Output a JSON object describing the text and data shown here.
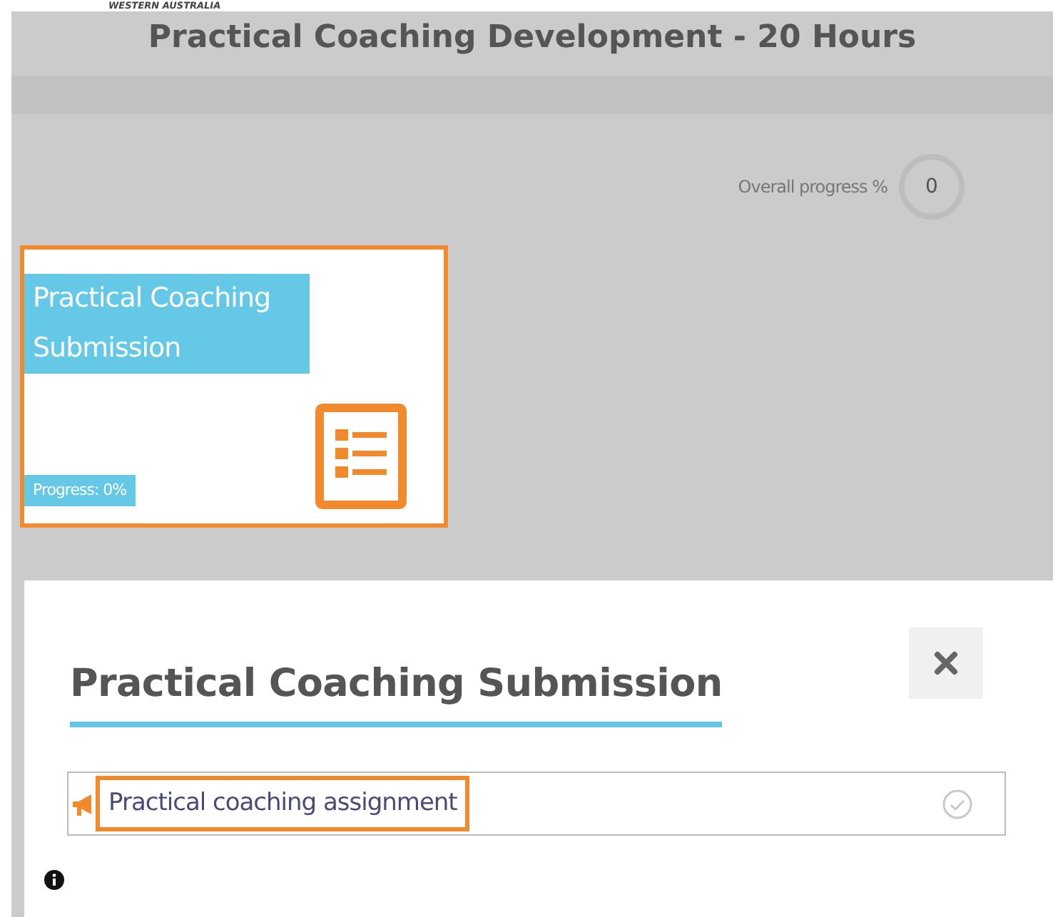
{
  "header": {
    "logo_caption": "WESTERN AUSTRALIA"
  },
  "course": {
    "title": "Practical Coaching Development - 20 Hours",
    "overall_progress_label": "Overall progress %",
    "overall_progress_value": "0"
  },
  "sections": [
    {
      "title": "Practical Coaching Submission",
      "progress": "Progress: 0%",
      "highlighted": true
    }
  ],
  "modal": {
    "title": "Practical Coaching Submission",
    "activities": [
      {
        "name": "Practical coaching assignment",
        "completed": false,
        "highlighted": true
      }
    ]
  }
}
